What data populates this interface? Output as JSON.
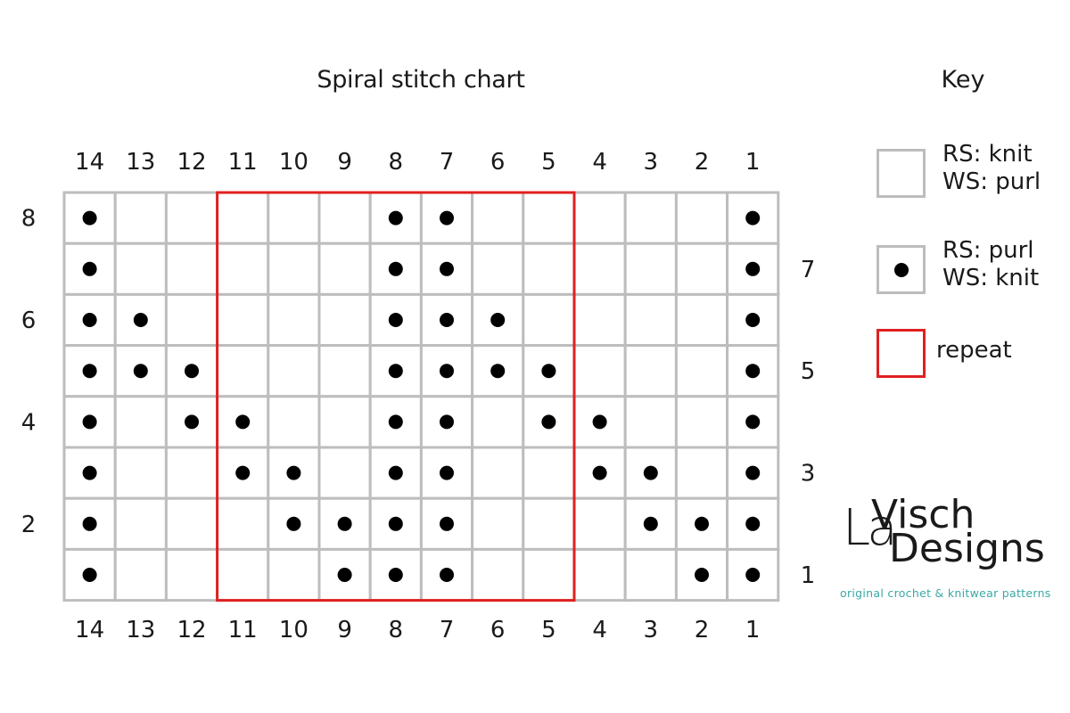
{
  "chart_title": "Spiral stitch chart",
  "key": {
    "title": "Key",
    "items": [
      {
        "symbol": "empty-square",
        "line1": "RS: knit",
        "line2": "WS: purl"
      },
      {
        "symbol": "dot-square",
        "line1": "RS: purl",
        "line2": "WS: knit"
      },
      {
        "symbol": "red-outline-square",
        "label": "repeat"
      }
    ]
  },
  "logo": {
    "name_part1": "La",
    "name_part2": "Visch",
    "name_part3": "Designs",
    "tagline": "original crochet & knitwear patterns",
    "tagline_color": "#3aa8a4"
  },
  "colors": {
    "grid_line": "#bdbdbd",
    "repeat_outline": "#e02020",
    "stitch_dot": "#000000"
  },
  "chart_data": {
    "type": "table",
    "title": "Spiral stitch chart",
    "columns": [
      14,
      13,
      12,
      11,
      10,
      9,
      8,
      7,
      6,
      5,
      4,
      3,
      2,
      1
    ],
    "rows": [
      8,
      7,
      6,
      5,
      4,
      3,
      2,
      1
    ],
    "row_labels_left": [
      8,
      6,
      4,
      2
    ],
    "row_labels_right": [
      7,
      5,
      3,
      1
    ],
    "cell_legend": {
      "0": "RS: knit / WS: purl",
      "1": "RS: purl / WS: knit"
    },
    "purl_stitches_by_row": {
      "8": [
        14,
        8,
        7,
        1
      ],
      "7": [
        14,
        8,
        7,
        1
      ],
      "6": [
        14,
        13,
        8,
        7,
        6,
        1
      ],
      "5": [
        14,
        13,
        12,
        8,
        7,
        6,
        5,
        1
      ],
      "4": [
        14,
        12,
        11,
        8,
        7,
        5,
        4,
        1
      ],
      "3": [
        14,
        11,
        10,
        8,
        7,
        4,
        3,
        1
      ],
      "2": [
        14,
        10,
        9,
        8,
        7,
        3,
        2,
        1
      ],
      "1": [
        14,
        9,
        8,
        7,
        2,
        1
      ]
    },
    "repeat": {
      "from_column": 11,
      "to_column": 5,
      "from_row": 1,
      "to_row": 8
    }
  }
}
